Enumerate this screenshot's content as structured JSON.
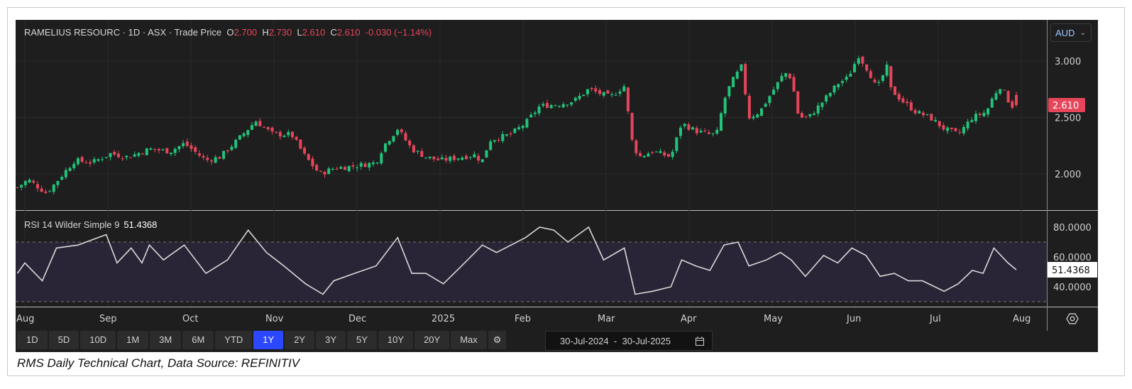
{
  "header": {
    "symbol": "RAMELIUS RESOURC",
    "interval": "1D",
    "exchange": "ASX",
    "price_type": "Trade Price",
    "open_label": "O",
    "open": "2.700",
    "high_label": "H",
    "high": "2.730",
    "low_label": "L",
    "low": "2.610",
    "close_label": "C",
    "close": "2.610",
    "change": "-0.030 (−1.14%)"
  },
  "currency": "AUD",
  "rsi": {
    "label": "RSI 14 Wilder Simple 9",
    "value": "51.4368"
  },
  "ranges": [
    "1D",
    "5D",
    "10D",
    "1M",
    "3M",
    "6M",
    "YTD",
    "1Y",
    "2Y",
    "3Y",
    "5Y",
    "10Y",
    "20Y",
    "Max"
  ],
  "active_range": "1Y",
  "date_range": {
    "from": "30-Jul-2024",
    "sep": "-",
    "to": "30-Jul-2025"
  },
  "caption": "RMS Daily Technical Chart, Data Source: REFINITIV",
  "colors": {
    "up": "#22c37a",
    "down": "#e6455a",
    "rsi_line": "#d8d8d8",
    "rsi_band": "#2a2536",
    "active": "#2c48ff"
  },
  "chart_data": {
    "type": "candlestick",
    "x_unit": "months since start of Aug 2024",
    "x_ticks": [
      {
        "t": 0,
        "label": "Aug"
      },
      {
        "t": 1,
        "label": "Sep"
      },
      {
        "t": 2,
        "label": "Oct"
      },
      {
        "t": 3,
        "label": "Nov"
      },
      {
        "t": 4,
        "label": "Dec"
      },
      {
        "t": 5,
        "label": "2025"
      },
      {
        "t": 6,
        "label": "Feb"
      },
      {
        "t": 7,
        "label": "Mar"
      },
      {
        "t": 8,
        "label": "Apr"
      },
      {
        "t": 9,
        "label": "May"
      },
      {
        "t": 10,
        "label": "Jun"
      },
      {
        "t": 11,
        "label": "Jul"
      },
      {
        "t": 12,
        "label": "Aug"
      }
    ],
    "price": {
      "ylim": [
        1.75,
        3.15
      ],
      "y_ticks": [
        "3.000",
        "2.500",
        "2.000"
      ],
      "last": "2.610",
      "close": [
        [
          -0.09,
          1.88
        ],
        [
          0.04,
          1.95
        ],
        [
          0.26,
          1.83
        ],
        [
          0.38,
          1.93
        ],
        [
          0.6,
          2.12
        ],
        [
          0.81,
          2.1
        ],
        [
          1.03,
          2.18
        ],
        [
          1.24,
          2.15
        ],
        [
          1.5,
          2.22
        ],
        [
          1.75,
          2.2
        ],
        [
          1.92,
          2.27
        ],
        [
          2.18,
          2.12
        ],
        [
          2.35,
          2.15
        ],
        [
          2.56,
          2.3
        ],
        [
          2.78,
          2.47
        ],
        [
          2.99,
          2.35
        ],
        [
          3.21,
          2.35
        ],
        [
          3.38,
          2.15
        ],
        [
          3.55,
          2.0
        ],
        [
          3.72,
          2.05
        ],
        [
          3.97,
          2.07
        ],
        [
          4.23,
          2.1
        ],
        [
          4.32,
          2.25
        ],
        [
          4.49,
          2.4
        ],
        [
          4.66,
          2.22
        ],
        [
          4.83,
          2.15
        ],
        [
          5.0,
          2.12
        ],
        [
          5.26,
          2.15
        ],
        [
          5.43,
          2.17
        ],
        [
          5.5,
          2.1
        ],
        [
          5.6,
          2.3
        ],
        [
          5.85,
          2.35
        ],
        [
          6.03,
          2.45
        ],
        [
          6.2,
          2.6
        ],
        [
          6.45,
          2.62
        ],
        [
          6.62,
          2.65
        ],
        [
          6.79,
          2.75
        ],
        [
          7.05,
          2.68
        ],
        [
          7.22,
          2.78
        ],
        [
          7.31,
          2.3
        ],
        [
          7.39,
          2.15
        ],
        [
          7.56,
          2.2
        ],
        [
          7.78,
          2.15
        ],
        [
          7.91,
          2.45
        ],
        [
          8.08,
          2.38
        ],
        [
          8.25,
          2.35
        ],
        [
          8.33,
          2.35
        ],
        [
          8.42,
          2.65
        ],
        [
          8.5,
          2.8
        ],
        [
          8.63,
          2.95
        ],
        [
          8.72,
          2.5
        ],
        [
          8.85,
          2.55
        ],
        [
          9.02,
          2.75
        ],
        [
          9.15,
          2.9
        ],
        [
          9.23,
          2.85
        ],
        [
          9.32,
          2.5
        ],
        [
          9.44,
          2.5
        ],
        [
          9.62,
          2.65
        ],
        [
          9.79,
          2.8
        ],
        [
          9.91,
          2.85
        ],
        [
          10.04,
          3.05
        ],
        [
          10.17,
          2.9
        ],
        [
          10.26,
          2.75
        ],
        [
          10.38,
          2.95
        ],
        [
          10.43,
          2.75
        ],
        [
          10.56,
          2.65
        ],
        [
          10.73,
          2.55
        ],
        [
          10.9,
          2.5
        ],
        [
          11.07,
          2.4
        ],
        [
          11.24,
          2.35
        ],
        [
          11.41,
          2.5
        ],
        [
          11.58,
          2.55
        ],
        [
          11.67,
          2.7
        ],
        [
          11.75,
          2.78
        ],
        [
          11.88,
          2.6
        ],
        [
          11.94,
          2.61
        ]
      ]
    },
    "rsi": {
      "ylim": [
        25,
        88
      ],
      "y_ticks": [
        "80.0000",
        "60.0000",
        "40.0000"
      ],
      "bands": [
        70,
        30
      ],
      "values": [
        [
          -0.09,
          49
        ],
        [
          0,
          56
        ],
        [
          0.21,
          44
        ],
        [
          0.38,
          66
        ],
        [
          0.64,
          68
        ],
        [
          0.98,
          75
        ],
        [
          1.11,
          56
        ],
        [
          1.28,
          66
        ],
        [
          1.41,
          56
        ],
        [
          1.5,
          68
        ],
        [
          1.67,
          58
        ],
        [
          1.92,
          68
        ],
        [
          2.18,
          49
        ],
        [
          2.44,
          58
        ],
        [
          2.69,
          78
        ],
        [
          2.91,
          63
        ],
        [
          3.12,
          54
        ],
        [
          3.38,
          42
        ],
        [
          3.59,
          35
        ],
        [
          3.72,
          44
        ],
        [
          3.97,
          49
        ],
        [
          4.23,
          54
        ],
        [
          4.49,
          73
        ],
        [
          4.66,
          49
        ],
        [
          4.83,
          49
        ],
        [
          5.04,
          42
        ],
        [
          5.26,
          54
        ],
        [
          5.51,
          68
        ],
        [
          5.68,
          63
        ],
        [
          6.03,
          73
        ],
        [
          6.2,
          80
        ],
        [
          6.37,
          78
        ],
        [
          6.54,
          70
        ],
        [
          6.79,
          80
        ],
        [
          6.97,
          58
        ],
        [
          7.22,
          66
        ],
        [
          7.35,
          35
        ],
        [
          7.56,
          37
        ],
        [
          7.78,
          40
        ],
        [
          7.91,
          58
        ],
        [
          8.08,
          54
        ],
        [
          8.25,
          51
        ],
        [
          8.42,
          68
        ],
        [
          8.59,
          70
        ],
        [
          8.72,
          54
        ],
        [
          8.93,
          58
        ],
        [
          9.1,
          63
        ],
        [
          9.23,
          58
        ],
        [
          9.4,
          47
        ],
        [
          9.62,
          61
        ],
        [
          9.79,
          56
        ],
        [
          9.96,
          66
        ],
        [
          10.13,
          61
        ],
        [
          10.3,
          47
        ],
        [
          10.47,
          49
        ],
        [
          10.64,
          44
        ],
        [
          10.81,
          44
        ],
        [
          11.07,
          37
        ],
        [
          11.24,
          42
        ],
        [
          11.41,
          51
        ],
        [
          11.54,
          49
        ],
        [
          11.67,
          66
        ],
        [
          11.84,
          56
        ],
        [
          11.94,
          51.44
        ]
      ]
    }
  }
}
